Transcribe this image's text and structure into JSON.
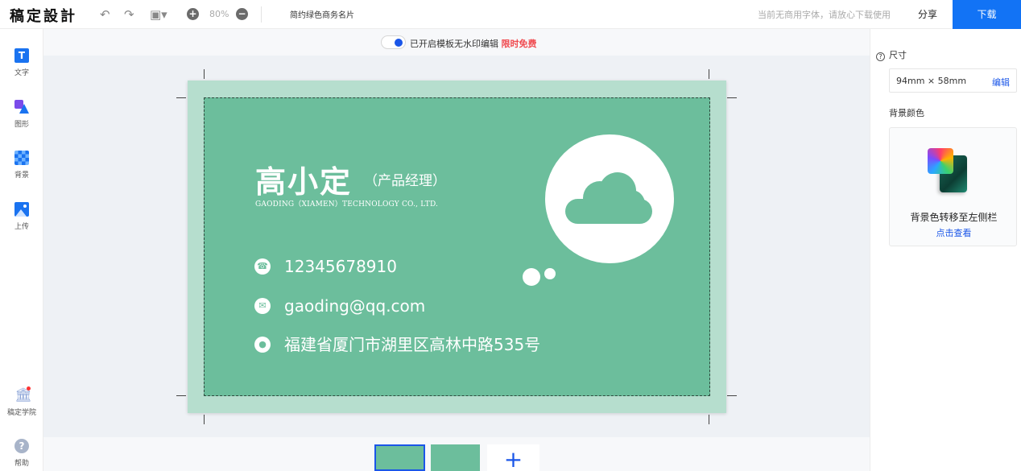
{
  "header": {
    "logo": "稿定設計",
    "zoom": "80%",
    "doc_title": "简约绿色商务名片",
    "font_notice": "当前无商用字体，请放心下载使用",
    "share_label": "分享",
    "download_label": "下载",
    "icons": [
      "undo-icon",
      "redo-icon",
      "save-icon",
      "zoom-in-icon",
      "zoom-out-icon"
    ]
  },
  "sidebar": {
    "items": [
      {
        "label": "文字",
        "icon": "text-icon"
      },
      {
        "label": "图形",
        "icon": "shape-icon"
      },
      {
        "label": "背景",
        "icon": "background-icon"
      },
      {
        "label": "上传",
        "icon": "upload-icon"
      }
    ],
    "bottom_items": [
      {
        "label": "稿定学院",
        "icon": "academy-icon"
      },
      {
        "label": "帮助",
        "icon": "help-icon"
      }
    ]
  },
  "notice": {
    "text": "已开启模板无水印编辑",
    "highlight": "限时免费",
    "toggle_on": true
  },
  "card": {
    "name": "高小定",
    "role": "（产品经理）",
    "company": "GAODING（XIAMEN）TECHNOLOGY CO., LTD.",
    "phone": "12345678910",
    "email": "gaoding@qq.com",
    "address": "福建省厦门市湖里区高林中路535号",
    "background_color": "#6cbe9c",
    "bleed_color": "#b6dece"
  },
  "pages": {
    "add_symbol": "+"
  },
  "panel": {
    "size_label": "尺寸",
    "size_value": "94mm × 58mm",
    "size_edit": "编辑",
    "bg_color_label": "背景颜色",
    "bg_note": "背景色转移至左侧栏",
    "bg_link": "点击查看"
  },
  "colors": {
    "accent": "#1273f5",
    "highlight_red": "#f04b50"
  }
}
